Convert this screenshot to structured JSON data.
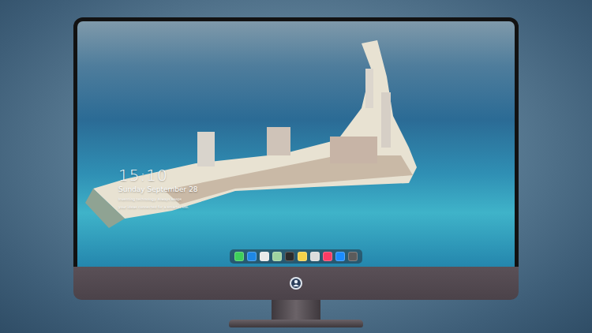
{
  "clock": {
    "time": "15:10",
    "date": "Sunday September 28",
    "caption": [
      "Inventing technology. Always keeps",
      "your ideas connected for a smarter life."
    ]
  },
  "dock": {
    "items": [
      {
        "color": "#3ecf5a"
      },
      {
        "color": "#1e88e5"
      },
      {
        "color": "#e9e9e9"
      },
      {
        "color": "#9fd3a0"
      },
      {
        "color": "#2c2c2c"
      },
      {
        "color": "#f5d24a"
      },
      {
        "color": "#dcdcdc"
      },
      {
        "color": "#fb3c64"
      },
      {
        "color": "#1a8cff"
      },
      {
        "color": "#5b5b5b"
      }
    ]
  }
}
